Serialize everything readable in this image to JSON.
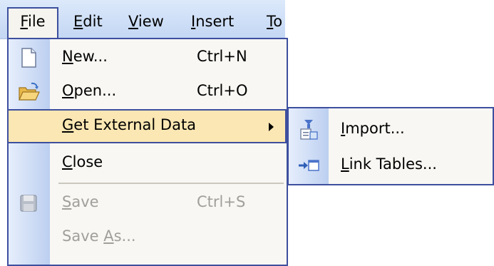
{
  "menubar": {
    "items": [
      {
        "label": "File",
        "mnemonic": "F",
        "rest": "ile"
      },
      {
        "label": "Edit",
        "mnemonic": "E",
        "rest": "dit"
      },
      {
        "label": "View",
        "mnemonic": "V",
        "rest": "iew"
      },
      {
        "label": "Insert",
        "mnemonic": "I",
        "rest": "nsert"
      },
      {
        "label": "To",
        "mnemonic": "T",
        "rest": "o"
      }
    ]
  },
  "file_menu": {
    "items": [
      {
        "pre": "",
        "mnemonic": "N",
        "post": "ew...",
        "shortcut": "Ctrl+N",
        "icon": "new-document-icon"
      },
      {
        "pre": "",
        "mnemonic": "O",
        "post": "pen...",
        "shortcut": "Ctrl+O",
        "icon": "open-folder-icon"
      },
      {
        "pre": "",
        "mnemonic": "G",
        "post": "et External Data",
        "shortcut": "",
        "icon": ""
      },
      {
        "pre": "",
        "mnemonic": "C",
        "post": "lose",
        "shortcut": "",
        "icon": ""
      },
      {
        "pre": "",
        "mnemonic": "S",
        "post": "ave",
        "shortcut": "Ctrl+S",
        "icon": "save-disk-icon"
      },
      {
        "pre": "Save ",
        "mnemonic": "A",
        "post": "s...",
        "shortcut": "",
        "icon": ""
      }
    ]
  },
  "submenu": {
    "items": [
      {
        "pre": "",
        "mnemonic": "I",
        "post": "mport...",
        "icon": "import-icon"
      },
      {
        "pre": "",
        "mnemonic": "L",
        "post": "ink Tables...",
        "icon": "link-tables-icon"
      }
    ]
  },
  "colors": {
    "accent_border": "#3d4f9e",
    "highlight": "#fbe7b3",
    "disabled_text": "#a09f9a"
  }
}
